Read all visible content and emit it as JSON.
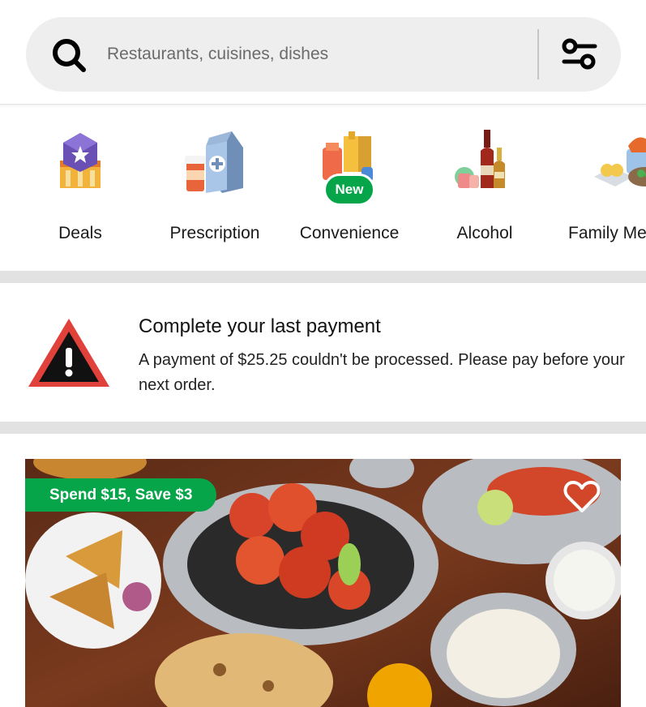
{
  "search": {
    "placeholder": "Restaurants, cuisines, dishes",
    "value": ""
  },
  "categories": [
    {
      "label": "Deals",
      "icon": "deals-icon"
    },
    {
      "label": "Prescription",
      "icon": "prescription-icon"
    },
    {
      "label": "Convenience",
      "icon": "convenience-icon",
      "badge": "New"
    },
    {
      "label": "Alcohol",
      "icon": "alcohol-icon"
    },
    {
      "label": "Family Me",
      "icon": "family-meals-icon"
    }
  ],
  "payment_notice": {
    "title": "Complete your last payment",
    "body": "A payment of $25.25 couldn't be processed. Please pay before your next order."
  },
  "store_card": {
    "promo": "Spend $15, Save $3"
  },
  "colors": {
    "accent_green": "#06a54a",
    "search_bg": "#eeeeee",
    "separator": "#e2e2e2",
    "warning_red": "#e0413a"
  }
}
